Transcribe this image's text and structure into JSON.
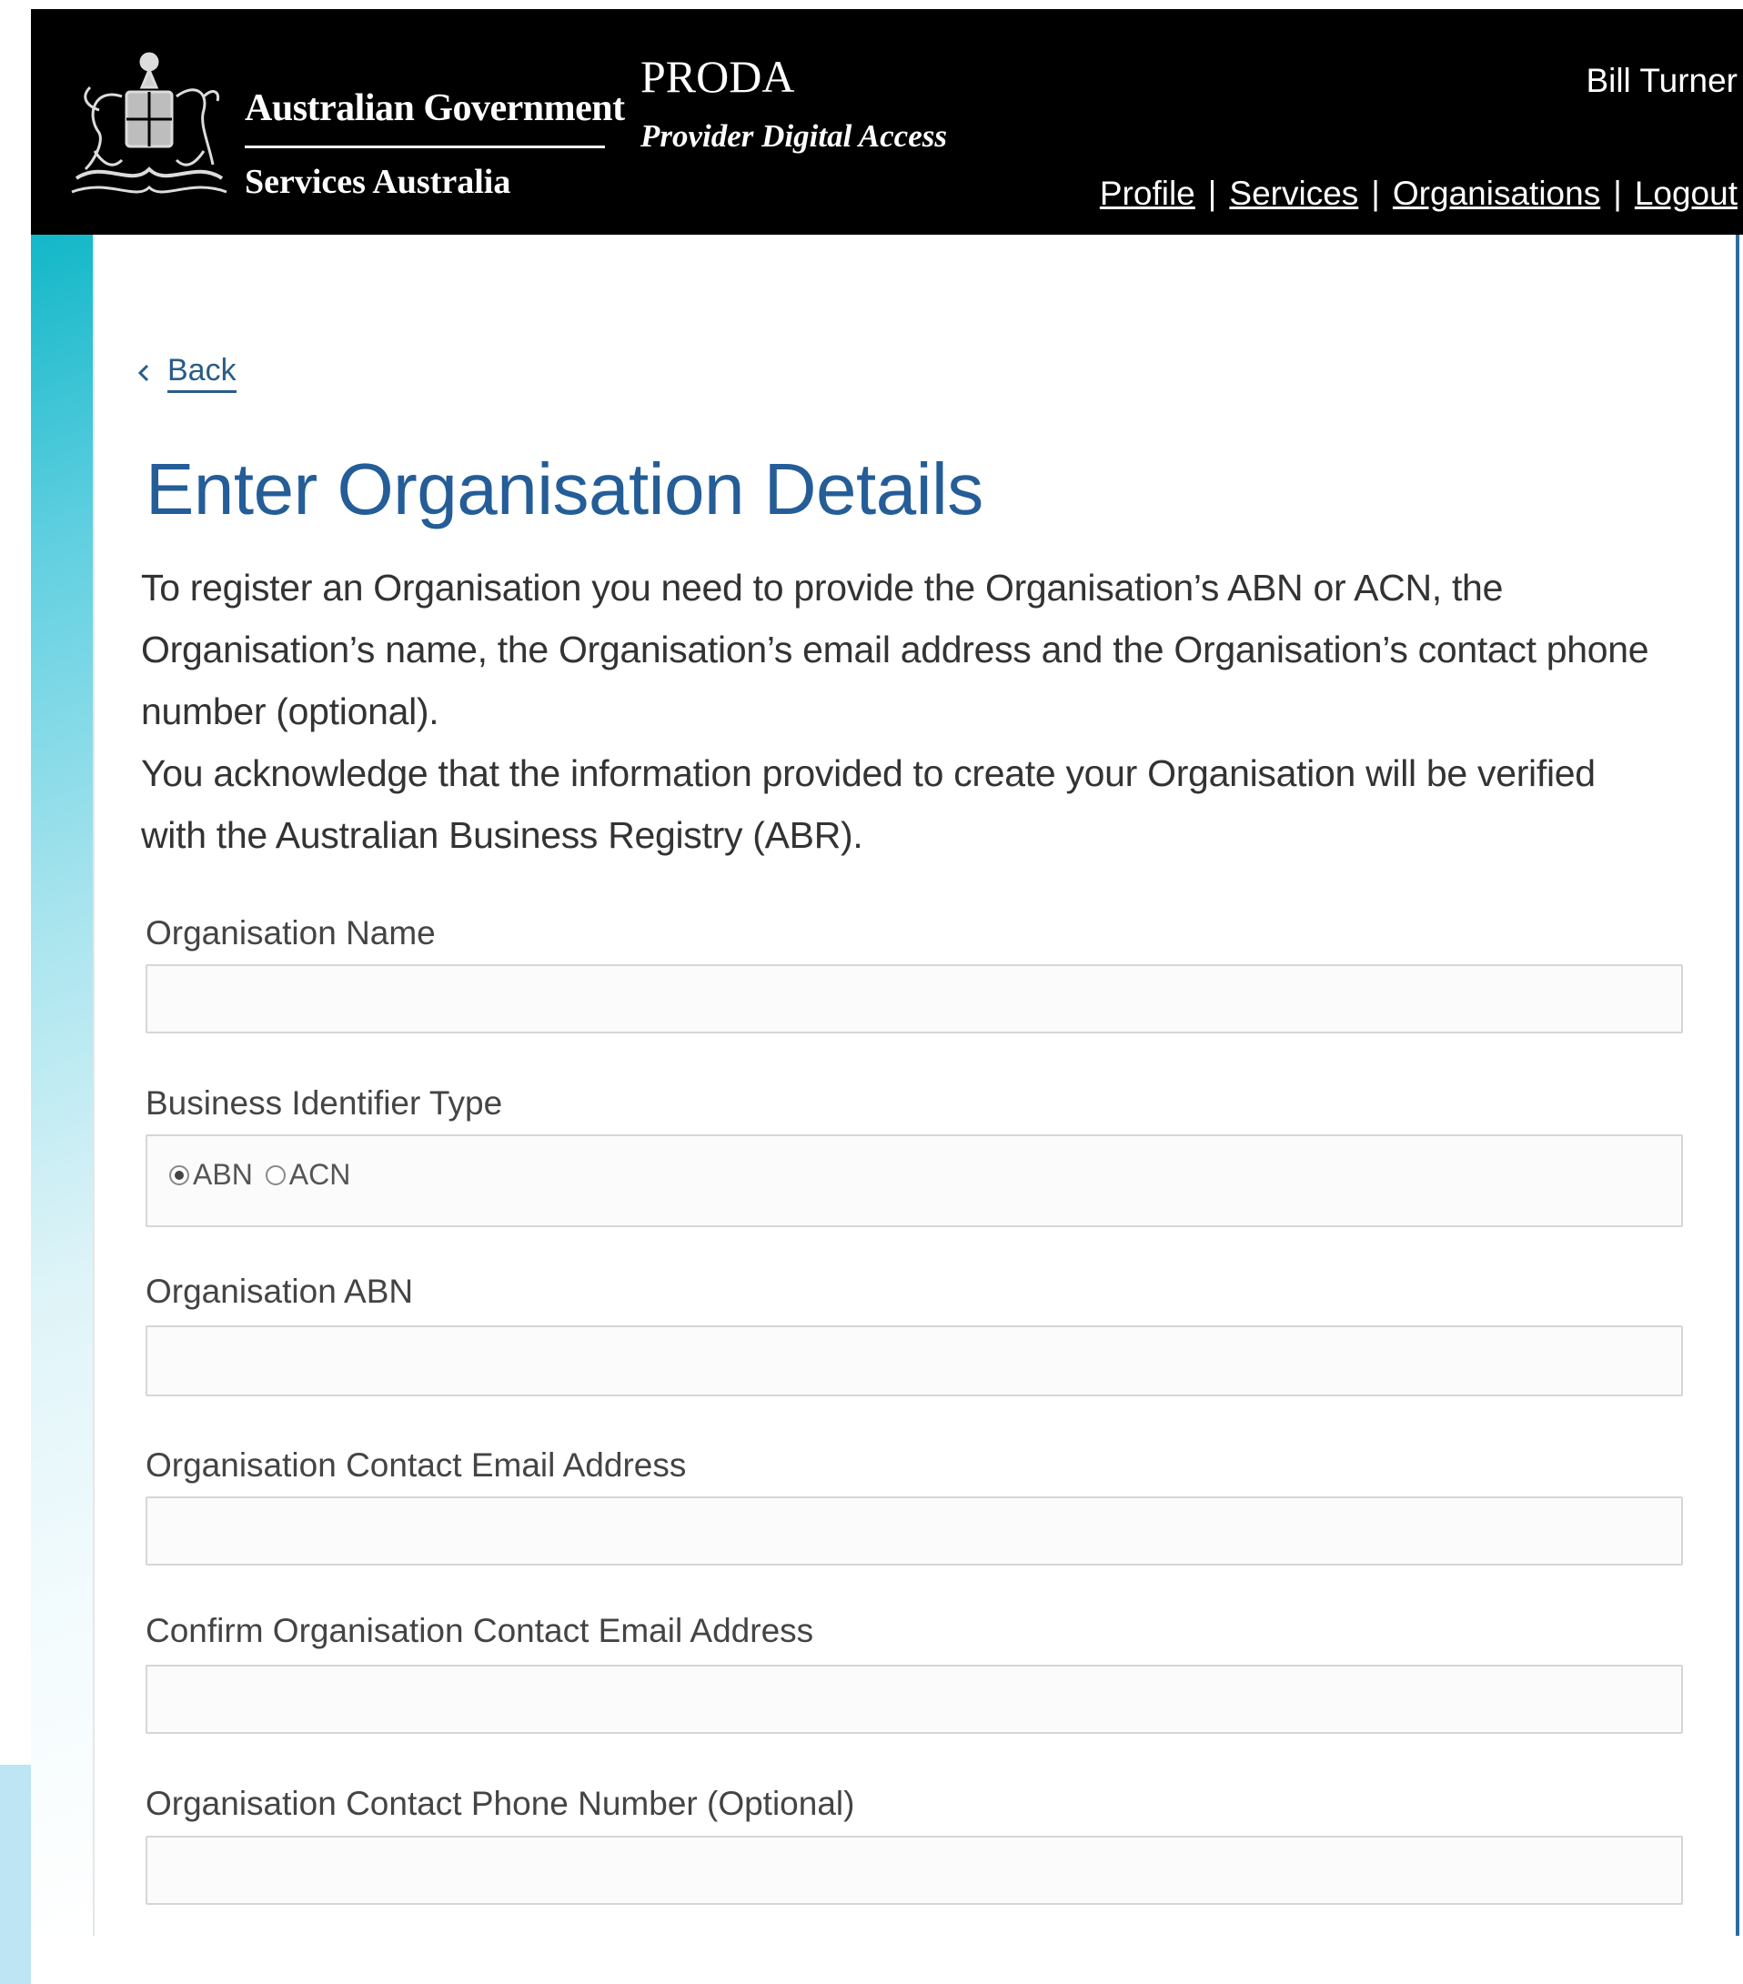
{
  "header": {
    "gov_name": "Australian Government",
    "gov_sub": "Services Australia",
    "app_title": "PRODA",
    "app_subtitle": "Provider Digital Access",
    "user_name": "Bill Turner",
    "nav": [
      {
        "label": "Profile"
      },
      {
        "label": "Services"
      },
      {
        "label": "Organisations"
      },
      {
        "label": "Logout"
      }
    ],
    "nav_separator": "|"
  },
  "back_label": "Back",
  "page_title": "Enter Organisation Details",
  "intro": [
    "To register an Organisation you need to provide the Organisation’s ABN or ACN, the Organisation’s name, the Organisation’s email address and the Organisation’s contact phone number (optional).",
    "You acknowledge that the information provided to create your Organisation will be verified with the Australian Business Registry (ABR)."
  ],
  "form": {
    "org_name": {
      "label": "Organisation Name",
      "value": ""
    },
    "identifier_type": {
      "label": "Business Identifier Type",
      "options": [
        "ABN",
        "ACN"
      ],
      "selected": "ABN"
    },
    "org_abn": {
      "label": "Organisation ABN",
      "value": ""
    },
    "email": {
      "label": "Organisation Contact Email Address",
      "value": ""
    },
    "confirm_email": {
      "label": "Confirm Organisation Contact Email Address",
      "value": ""
    },
    "phone": {
      "label": "Organisation Contact Phone Number (Optional)",
      "value": ""
    }
  },
  "colors": {
    "header_bg": "#000000",
    "title": "#245d97",
    "link": "#2a5c8a",
    "accent_teal": "#12b7c8"
  },
  "icons": [
    "coat-of-arms-icon",
    "chevron-left-icon"
  ]
}
